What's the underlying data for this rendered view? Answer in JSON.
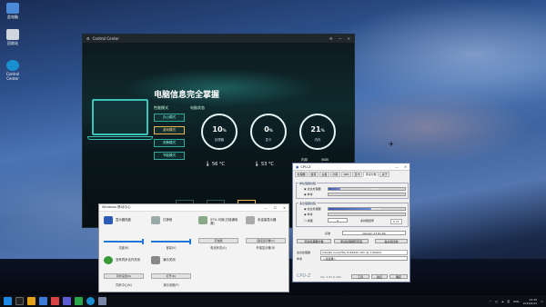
{
  "desktop": {
    "icons": [
      {
        "label": "此电脑",
        "icon": "computer-icon"
      },
      {
        "label": "回收站",
        "icon": "recycle-bin-icon"
      },
      {
        "label": "Control Center",
        "icon": "control-center-icon"
      }
    ]
  },
  "control_center": {
    "title": "Control Center",
    "heading": "电脑信息完全掌握",
    "mode_label": "性能模式",
    "status_label": "电脑状态",
    "modes": [
      "办公模式",
      "游戏模式",
      "安静模式",
      "节能模式"
    ],
    "active_mode": "游戏模式",
    "rings": [
      {
        "value": "10",
        "unit": "%",
        "label": "处理器"
      },
      {
        "value": "0",
        "unit": "%",
        "label": "显卡"
      },
      {
        "value": "21",
        "unit": "%",
        "label": "内存"
      }
    ],
    "cpu_temp": "56 °C",
    "gpu_temp": "53 °C",
    "memory_label": "内存",
    "memory_value": "8GB",
    "nav": [
      "",
      "性能监控",
      "风扇控制"
    ]
  },
  "mobility_center": {
    "title": "Windows 移动中心",
    "tiles": [
      {
        "name": "显示器亮度",
        "caption": "亮度(B)",
        "icon": "brightness-icon"
      },
      {
        "name": "已静音",
        "caption": "音量(V)",
        "icon": "speaker-icon"
      },
      {
        "name": "97% 可用(已接通电源)",
        "caption": "电池状态(A)",
        "control": "高性能",
        "icon": "battery-icon"
      },
      {
        "name": "未连接显示器",
        "caption": "外接显示器(D)",
        "control": "连接显示器(C)",
        "icon": "projector-icon"
      },
      {
        "name": "没有同步合作关系",
        "caption": "同步中心(N)",
        "control": "同步设置(S)",
        "icon": "sync-icon"
      },
      {
        "name": "演示关闭",
        "caption": "演示设置(P)",
        "control": "打开(O)",
        "icon": "presentation-icon"
      }
    ]
  },
  "cpuz": {
    "title": "CPU-Z",
    "tabs": [
      "处理器",
      "缓存",
      "主板",
      "内存",
      "SPD",
      "显卡",
      "测试分数",
      "关于"
    ],
    "active_tab": "测试分数",
    "single_group": "单处理器线程",
    "multi_group": "多处理器线程",
    "this_cpu": "这台处理器",
    "reference": "参考",
    "this_single": "497.2",
    "multi_this": "2597.6",
    "threads_label": "线程",
    "threads_value": "4",
    "ratio_label": "多线程倍率",
    "ratio_value": "5.71",
    "baseline_label": "基准",
    "baseline_value": "Version 17.01.64",
    "btn_bench": "测试处理器分数",
    "btn_stress": "测试处理器稳定度",
    "btn_submit": "提交和比较",
    "this_proc_label": "这台处理器",
    "this_proc_value": "Intel(R) Core(TM) i5-8265U CPU @ 1.60GHz",
    "ref_label": "参考",
    "ref_value": "<请选择>",
    "footer_version": "Ver. 1.87.0.x64",
    "tools": "工具",
    "validate": "验证",
    "ok": "确定"
  },
  "taskbar": {
    "time": "22:40",
    "date": "2019/6/22",
    "lang": "英",
    "tray_text": "ENG"
  },
  "colors": {
    "accent": "#3cc4b8",
    "active_mode": "#e7b94a",
    "cpuz_bar": "#3a54b4"
  }
}
